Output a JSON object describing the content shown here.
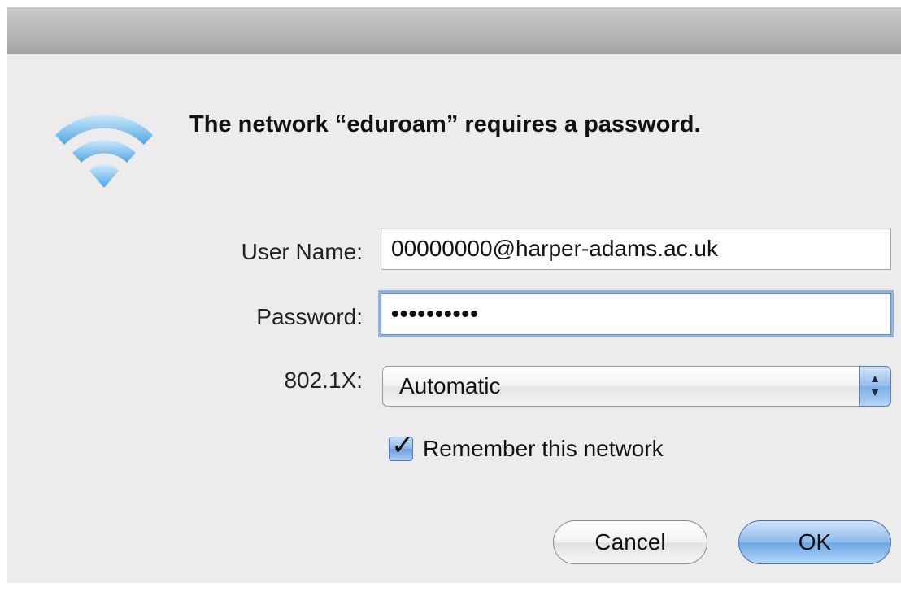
{
  "dialog": {
    "message": "The network “eduroam” requires a password.",
    "icon": "wifi-icon"
  },
  "form": {
    "username_label": "User Name:",
    "username_value": "00000000@harper-adams.ac.uk",
    "password_label": "Password:",
    "password_masked": "••••••••••",
    "security_label": "802.1X:",
    "security_value": "Automatic",
    "remember_label": "Remember this network",
    "remember_checked": true
  },
  "buttons": {
    "cancel": "Cancel",
    "ok": "OK"
  },
  "colors": {
    "accent": "#6aa6e4",
    "dialog_bg": "#ececec"
  }
}
